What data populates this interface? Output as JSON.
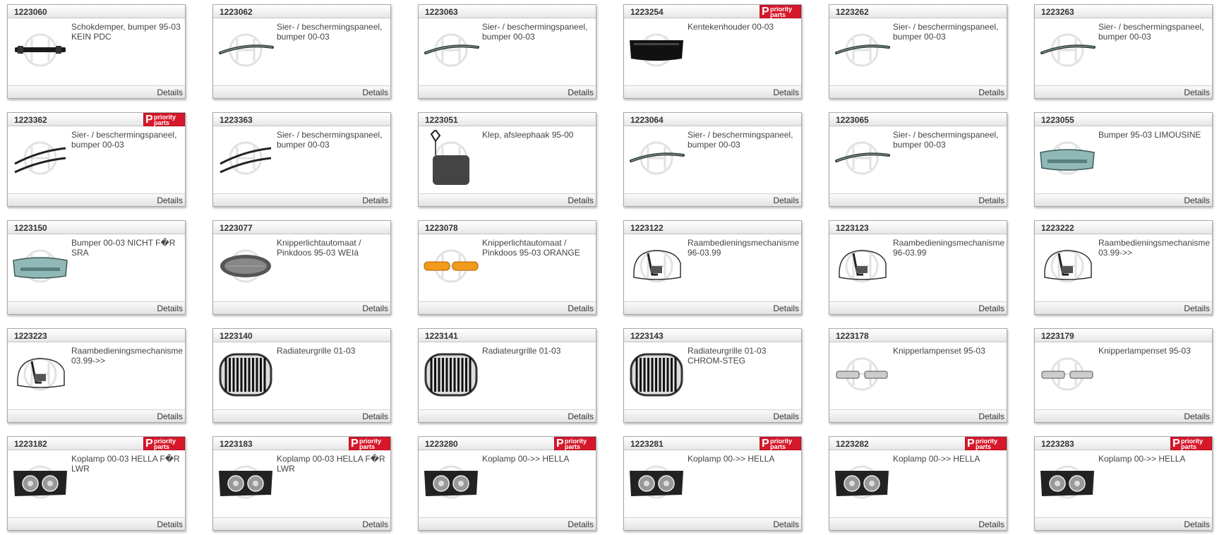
{
  "priority_badge": {
    "letter": "P",
    "text": "priority\nparts"
  },
  "details_label": "Details",
  "products": [
    {
      "code": "1223060",
      "desc": "Schokdemper, bumper 95-03\nKEIN PDC",
      "badge": false,
      "icon": "bumper-beam-icon"
    },
    {
      "code": "1223062",
      "desc": "Sier- / beschermingspaneel,\nbumper 00-03",
      "badge": false,
      "icon": "trim-strip-icon"
    },
    {
      "code": "1223063",
      "desc": "Sier- / beschermingspaneel,\nbumper 00-03",
      "badge": false,
      "icon": "trim-strip-icon"
    },
    {
      "code": "1223254",
      "desc": "Kentekenhouder 00-03",
      "badge": true,
      "icon": "license-plate-holder-icon"
    },
    {
      "code": "1223262",
      "desc": "Sier- / beschermingspaneel,\nbumper 00-03",
      "badge": false,
      "icon": "trim-strip-icon"
    },
    {
      "code": "1223263",
      "desc": "Sier- / beschermingspaneel,\nbumper 00-03",
      "badge": false,
      "icon": "trim-strip-icon"
    },
    {
      "code": "1223362",
      "desc": "Sier- / beschermingspaneel,\nbumper 00-03",
      "badge": true,
      "icon": "trim-strip-pair-icon"
    },
    {
      "code": "1223363",
      "desc": "Sier- / beschermingspaneel,\nbumper 00-03",
      "badge": false,
      "icon": "trim-strip-pair-icon"
    },
    {
      "code": "1223051",
      "desc": "Klep, afsleephaak 95-00",
      "badge": false,
      "icon": "tow-hook-cover-icon"
    },
    {
      "code": "1223064",
      "desc": "Sier- / beschermingspaneel,\nbumper 00-03",
      "badge": false,
      "icon": "trim-strip-icon"
    },
    {
      "code": "1223065",
      "desc": "Sier- / beschermingspaneel,\nbumper 00-03",
      "badge": false,
      "icon": "trim-strip-icon"
    },
    {
      "code": "1223055",
      "desc": "Bumper 95-03 LIMOUSINE",
      "badge": false,
      "icon": "bumper-icon"
    },
    {
      "code": "1223150",
      "desc": "Bumper 00-03 NICHT F�R\nSRA",
      "badge": false,
      "icon": "bumper-icon"
    },
    {
      "code": "1223077",
      "desc": "Knipperlichtautomaat /\nPinkdoos 95-03 WEIá",
      "badge": false,
      "icon": "side-indicator-icon"
    },
    {
      "code": "1223078",
      "desc": "Knipperlichtautomaat /\nPinkdoos 95-03 ORANGE",
      "badge": false,
      "icon": "side-indicator-pair-icon"
    },
    {
      "code": "1223122",
      "desc": "Raambedieningsmechanisme\n96-03.99",
      "badge": false,
      "icon": "window-regulator-icon"
    },
    {
      "code": "1223123",
      "desc": "Raambedieningsmechanisme\n96-03.99",
      "badge": false,
      "icon": "window-regulator-icon"
    },
    {
      "code": "1223222",
      "desc": "Raambedieningsmechanisme\n03.99->>",
      "badge": false,
      "icon": "window-regulator-icon"
    },
    {
      "code": "1223223",
      "desc": "Raambedieningsmechanisme\n03.99->>",
      "badge": false,
      "icon": "window-regulator-icon"
    },
    {
      "code": "1223140",
      "desc": "Radiateurgrille 01-03",
      "badge": false,
      "icon": "kidney-grille-icon"
    },
    {
      "code": "1223141",
      "desc": "Radiateurgrille 01-03",
      "badge": false,
      "icon": "kidney-grille-icon"
    },
    {
      "code": "1223143",
      "desc": "Radiateurgrille 01-03\nCHROM-STEG",
      "badge": false,
      "icon": "kidney-grille-icon"
    },
    {
      "code": "1223178",
      "desc": "Knipperlampenset 95-03",
      "badge": false,
      "icon": "indicator-set-icon"
    },
    {
      "code": "1223179",
      "desc": "Knipperlampenset 95-03",
      "badge": false,
      "icon": "indicator-set-icon"
    },
    {
      "code": "1223182",
      "desc": "Koplamp 00-03 HELLA F�R\nLWR",
      "badge": true,
      "icon": "headlamp-icon"
    },
    {
      "code": "1223183",
      "desc": "Koplamp 00-03 HELLA F�R\nLWR",
      "badge": true,
      "icon": "headlamp-icon"
    },
    {
      "code": "1223280",
      "desc": "Koplamp 00->> HELLA",
      "badge": true,
      "icon": "headlamp-icon"
    },
    {
      "code": "1223281",
      "desc": "Koplamp 00->> HELLA",
      "badge": true,
      "icon": "headlamp-icon"
    },
    {
      "code": "1223282",
      "desc": "Koplamp 00->> HELLA",
      "badge": true,
      "icon": "headlamp-icon"
    },
    {
      "code": "1223283",
      "desc": "Koplamp 00->> HELLA",
      "badge": true,
      "icon": "headlamp-icon"
    }
  ]
}
